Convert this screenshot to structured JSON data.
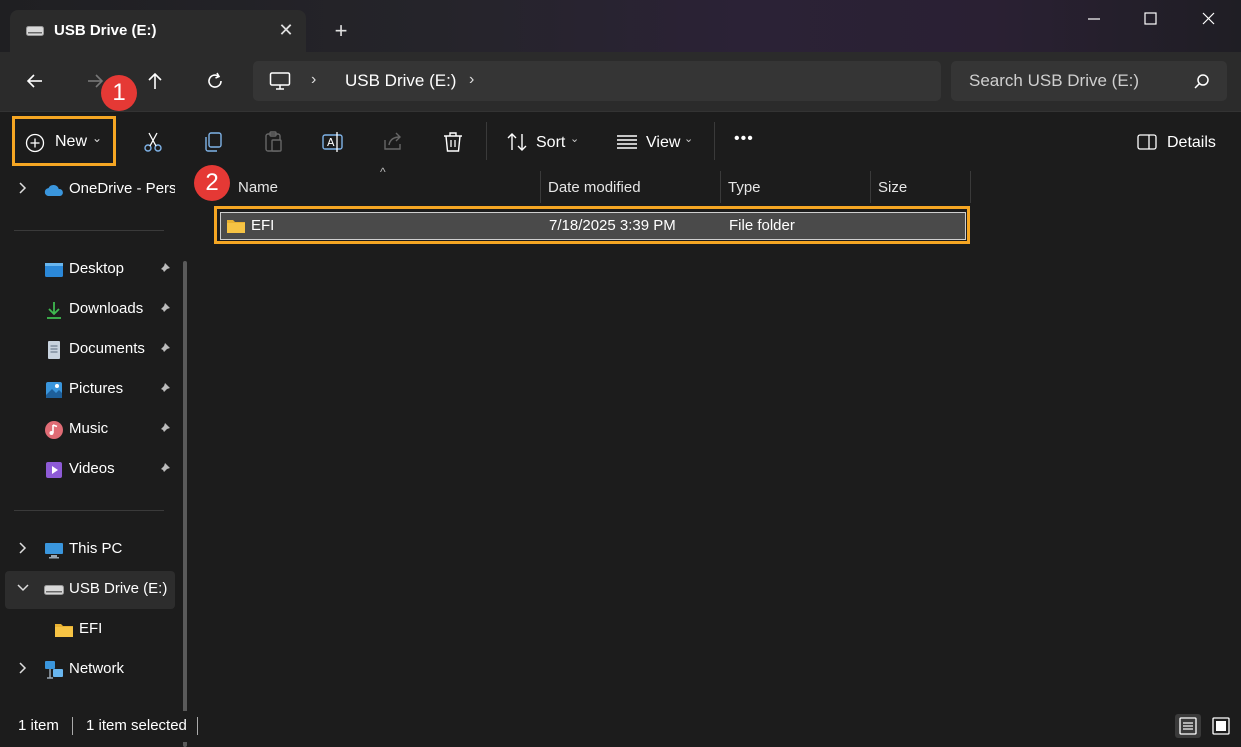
{
  "window": {
    "tab_title": "USB Drive (E:)",
    "tab_close_glyph": "✕",
    "new_tab_glyph": "+"
  },
  "address_bar": {
    "location": "USB Drive (E:)",
    "separator_glyph": "›"
  },
  "search": {
    "placeholder": "Search USB Drive (E:)"
  },
  "toolbar": {
    "new_label": "New",
    "sort_label": "Sort",
    "view_label": "View",
    "details_label": "Details",
    "dropdown_glyph": "⌄",
    "more_glyph": "•••"
  },
  "sidebar": {
    "onedrive": "OneDrive - Perso",
    "quick_access": [
      {
        "label": "Desktop",
        "icon": "desktop-icon"
      },
      {
        "label": "Downloads",
        "icon": "downloads-icon"
      },
      {
        "label": "Documents",
        "icon": "documents-icon"
      },
      {
        "label": "Pictures",
        "icon": "pictures-icon"
      },
      {
        "label": "Music",
        "icon": "music-icon"
      },
      {
        "label": "Videos",
        "icon": "videos-icon"
      }
    ],
    "this_pc": "This PC",
    "usb_drive": "USB Drive (E:)",
    "usb_child": "EFI",
    "network": "Network"
  },
  "file_list": {
    "columns": [
      "Name",
      "Date modified",
      "Type",
      "Size"
    ],
    "sort_indicator": "^",
    "rows": [
      {
        "name": "EFI",
        "date_modified": "7/18/2025 3:39 PM",
        "type": "File folder",
        "size": ""
      }
    ]
  },
  "annotations": {
    "step1": "1",
    "step2": "2",
    "highlight_color": "#f5a623",
    "badge_color": "#e53935"
  },
  "status": {
    "item_count": "1 item",
    "selected": "1 item selected"
  },
  "colors": {
    "background": "#1c1c1c",
    "folder": "#f6c344",
    "accent": "#60cdff"
  }
}
